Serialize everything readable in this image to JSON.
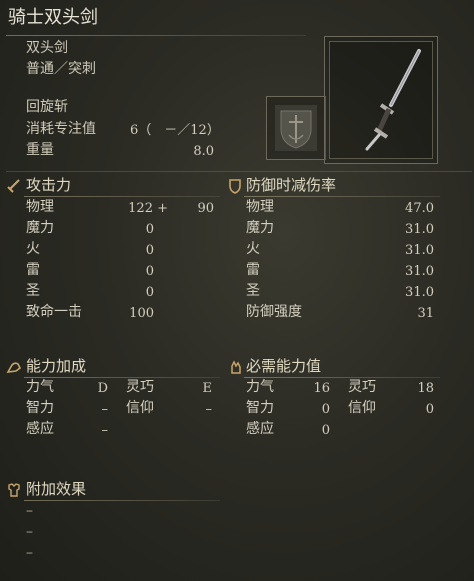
{
  "weapon": {
    "name": "骑士双头剑",
    "type": "双头剑",
    "attack_type": "普通／突刺",
    "skill": "回旋斩",
    "fp_cost_label": "消耗专注值",
    "fp_cost_value": "6（　－／12）",
    "weight_label": "重量",
    "weight_value": "8.0"
  },
  "attack": {
    "header": "攻击力",
    "rows": [
      {
        "label": "物理",
        "value": "122 +",
        "extra": "90"
      },
      {
        "label": "魔力",
        "value": "0",
        "extra": ""
      },
      {
        "label": "火",
        "value": "0",
        "extra": ""
      },
      {
        "label": "雷",
        "value": "0",
        "extra": ""
      },
      {
        "label": "圣",
        "value": "0",
        "extra": ""
      },
      {
        "label": "致命一击",
        "value": "100",
        "extra": ""
      }
    ]
  },
  "guard": {
    "header": "防御时减伤率",
    "rows": [
      {
        "label": "物理",
        "value": "47.0"
      },
      {
        "label": "魔力",
        "value": "31.0"
      },
      {
        "label": "火",
        "value": "31.0"
      },
      {
        "label": "雷",
        "value": "31.0"
      },
      {
        "label": "圣",
        "value": "31.0"
      },
      {
        "label": "防御强度",
        "value": "31"
      }
    ]
  },
  "scaling": {
    "header": "能力加成",
    "str_label": "力气",
    "str_value": "D",
    "dex_label": "灵巧",
    "dex_value": "E",
    "int_label": "智力",
    "int_value": "–",
    "fai_label": "信仰",
    "fai_value": "–",
    "arc_label": "感应",
    "arc_value": "–"
  },
  "requirements": {
    "header": "必需能力值",
    "str_label": "力气",
    "str_value": "16",
    "dex_label": "灵巧",
    "dex_value": "18",
    "int_label": "智力",
    "int_value": "0",
    "fai_label": "信仰",
    "fai_value": "0",
    "arc_label": "感应",
    "arc_value": "0"
  },
  "passive": {
    "header": "附加效果",
    "items": [
      "–",
      "–",
      "–"
    ]
  }
}
